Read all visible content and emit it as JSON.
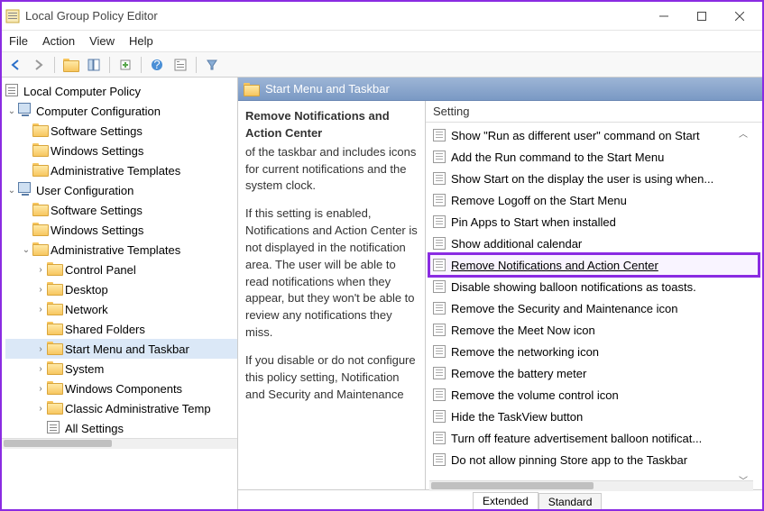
{
  "window": {
    "title": "Local Group Policy Editor"
  },
  "menubar": [
    "File",
    "Action",
    "View",
    "Help"
  ],
  "tree": {
    "root": "Local Computer Policy",
    "nodes": [
      {
        "label": "Computer Configuration",
        "icon": "comp",
        "expanded": true,
        "children": [
          {
            "label": "Software Settings",
            "icon": "folder"
          },
          {
            "label": "Windows Settings",
            "icon": "folder"
          },
          {
            "label": "Administrative Templates",
            "icon": "folder"
          }
        ]
      },
      {
        "label": "User Configuration",
        "icon": "comp",
        "expanded": true,
        "children": [
          {
            "label": "Software Settings",
            "icon": "folder"
          },
          {
            "label": "Windows Settings",
            "icon": "folder"
          },
          {
            "label": "Administrative Templates",
            "icon": "folder",
            "expanded": true,
            "children": [
              {
                "label": "Control Panel",
                "icon": "folder",
                "expandable": true
              },
              {
                "label": "Desktop",
                "icon": "folder",
                "expandable": true
              },
              {
                "label": "Network",
                "icon": "folder",
                "expandable": true
              },
              {
                "label": "Shared Folders",
                "icon": "folder"
              },
              {
                "label": "Start Menu and Taskbar",
                "icon": "folder",
                "expandable": true,
                "selected": true
              },
              {
                "label": "System",
                "icon": "folder",
                "expandable": true
              },
              {
                "label": "Windows Components",
                "icon": "folder",
                "expandable": true
              },
              {
                "label": "Classic Administrative Temp",
                "icon": "folder",
                "expandable": true
              },
              {
                "label": "All Settings",
                "icon": "policy"
              }
            ]
          }
        ]
      }
    ]
  },
  "right": {
    "header": "Start Menu and Taskbar",
    "detail_title": "Remove Notifications and Action Center",
    "detail_body1": "of the taskbar and includes icons for current notifications and the system clock.",
    "detail_body2": "If this setting is enabled, Notifications and Action Center is not displayed in the notification area. The user will be able to read notifications when they appear, but they won't be able to review any notifications they miss.",
    "detail_body3": "If you disable or do not configure this policy setting, Notification and Security and Maintenance",
    "list_header": "Setting",
    "settings": [
      "Show \"Run as different user\" command on Start",
      "Add the Run command to the Start Menu",
      "Show Start on the display the user is using when...",
      "Remove Logoff on the Start Menu",
      "Pin Apps to Start when installed",
      "Show additional calendar",
      "Remove Notifications and Action Center",
      "Disable showing balloon notifications as toasts.",
      "Remove the Security and Maintenance icon",
      "Remove the Meet Now icon",
      "Remove the networking icon",
      "Remove the battery meter",
      "Remove the volume control icon",
      "Hide the TaskView button",
      "Turn off feature advertisement balloon notificat...",
      "Do not allow pinning Store app to the Taskbar"
    ],
    "highlighted_index": 6
  },
  "tabs": {
    "extended": "Extended",
    "standard": "Standard",
    "active": "extended"
  }
}
